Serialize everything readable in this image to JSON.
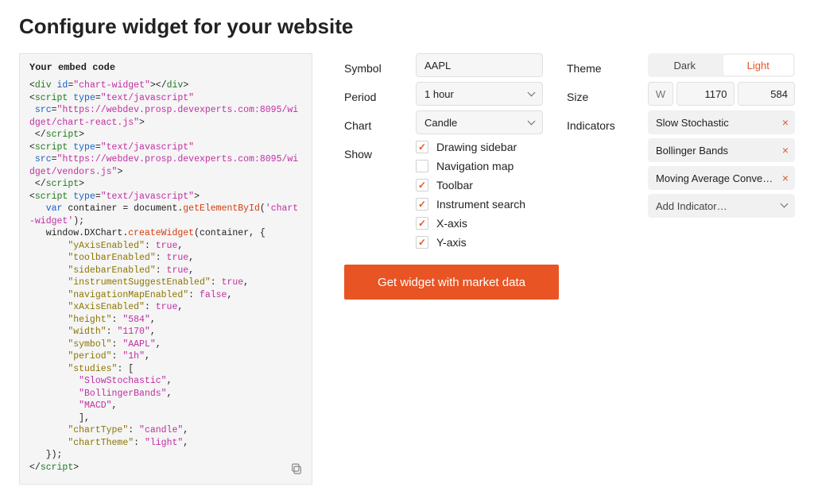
{
  "title": "Configure widget for your website",
  "code": {
    "header": "Your embed code",
    "div_id": "chart-widget",
    "src1": "https://webdev.prosp.devexperts.com:8095/widget/chart-react.js",
    "src2": "https://webdev.prosp.devexperts.com:8095/widget/vendors.js",
    "container_id": "chart-widget",
    "opts": {
      "yAxisEnabled": "true",
      "toolbarEnabled": "true",
      "sidebarEnabled": "true",
      "instrumentSuggestEnabled": "true",
      "navigationMapEnabled": "false",
      "xAxisEnabled": "true",
      "height": "584",
      "width": "1170",
      "symbol": "AAPL",
      "period": "1h",
      "studies": [
        "SlowStochastic",
        "BollingerBands",
        "MACD"
      ],
      "chartType": "candle",
      "chartTheme": "light"
    }
  },
  "form": {
    "symbol": {
      "label": "Symbol",
      "value": "AAPL"
    },
    "period": {
      "label": "Period",
      "value": "1 hour"
    },
    "chart": {
      "label": "Chart",
      "value": "Candle"
    },
    "show": {
      "label": "Show",
      "items": [
        {
          "label": "Drawing sidebar",
          "checked": true
        },
        {
          "label": "Navigation map",
          "checked": false
        },
        {
          "label": "Toolbar",
          "checked": true
        },
        {
          "label": "Instrument search",
          "checked": true
        },
        {
          "label": "X-axis",
          "checked": true
        },
        {
          "label": "Y-axis",
          "checked": true
        }
      ]
    },
    "theme": {
      "label": "Theme",
      "options": [
        "Dark",
        "Light"
      ],
      "active": "Light"
    },
    "size": {
      "label": "Size",
      "w_placeholder": "W",
      "width": "1170",
      "height": "584"
    },
    "indicators": {
      "label": "Indicators",
      "items": [
        "Slow Stochastic",
        "Bollinger Bands",
        "Moving Average Converg…"
      ],
      "add": "Add Indicator…"
    }
  },
  "cta": "Get widget with market data"
}
